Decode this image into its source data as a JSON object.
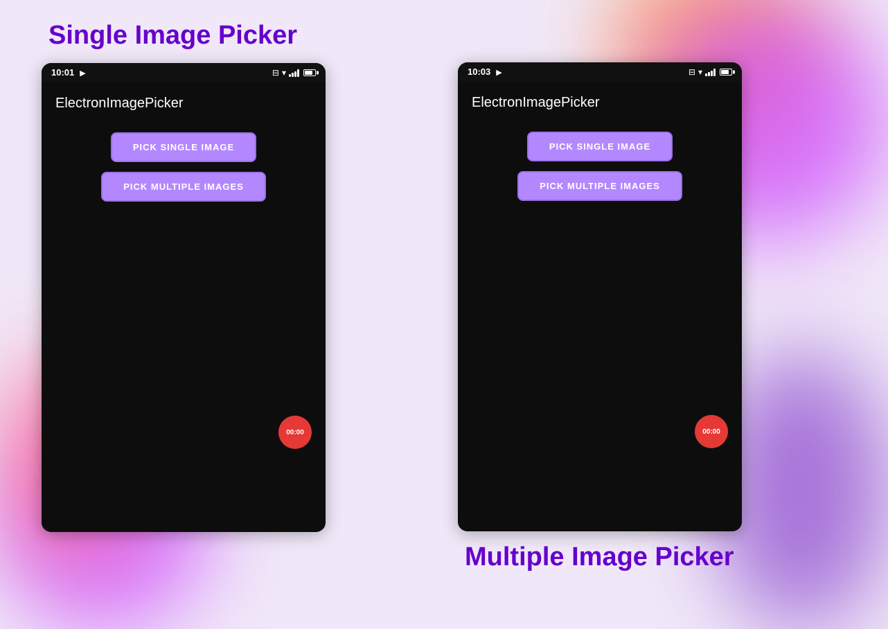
{
  "page": {
    "background_color": "#f0e8f8"
  },
  "left_section": {
    "title": "Single Image Picker",
    "phone": {
      "status_time": "10:01",
      "app_title": "ElectronImagePicker",
      "btn_single": "PICK SINGLE IMAGE",
      "btn_multiple": "PICK MULTIPLE IMAGES",
      "record_time": "00:00"
    }
  },
  "right_section": {
    "title": "Multiple Image Picker",
    "phone": {
      "status_time": "10:03",
      "app_title": "ElectronImagePicker",
      "btn_single": "PICK SINGLE IMAGE",
      "btn_multiple": "PICK MULTIPLE IMAGES",
      "record_time": "00:00"
    }
  }
}
